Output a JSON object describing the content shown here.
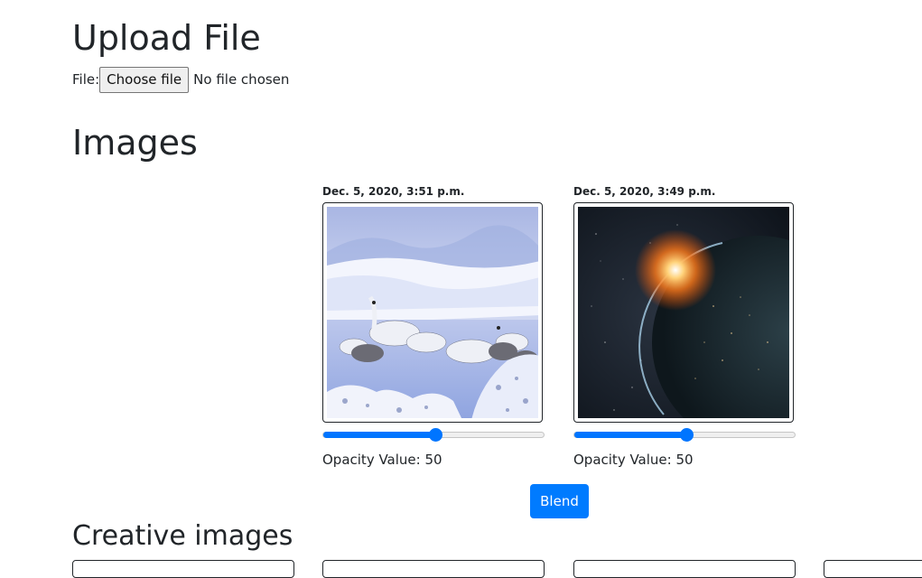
{
  "upload": {
    "title": "Upload File",
    "file_label": "File:",
    "choose_button": "Choose file",
    "no_file_text": "No file chosen"
  },
  "images": {
    "title": "Images",
    "cards": [
      {
        "date": "Dec. 5, 2020, 3:51 p.m.",
        "image_icon": "swans-winter-photo",
        "opacity_label": "Opacity Value: 50",
        "opacity": 0.5
      },
      {
        "date": "Dec. 5, 2020, 3:49 p.m.",
        "image_icon": "planet-space-photo",
        "opacity_label": "Opacity Value: 50",
        "opacity": 0.5
      }
    ],
    "blend_button": "Blend"
  },
  "creative": {
    "title": "Creative images"
  },
  "colors": {
    "accent": "#007bff",
    "slider": "#0075ff",
    "text": "#212529"
  }
}
